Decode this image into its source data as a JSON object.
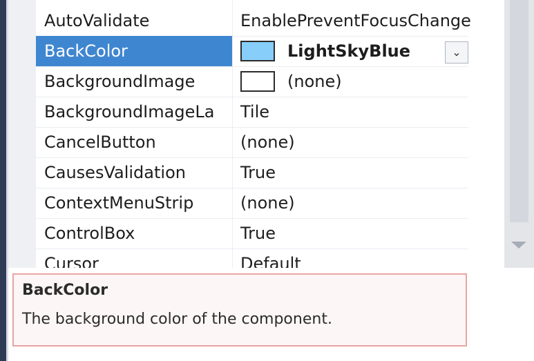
{
  "properties": [
    {
      "name": "AutoValidate",
      "value": "EnablePreventFocusChange"
    },
    {
      "name": "BackColor",
      "value": "LightSkyBlue",
      "selected": true
    },
    {
      "name": "BackgroundImage",
      "value": "(none)"
    },
    {
      "name": "BackgroundImageLa",
      "value": "Tile"
    },
    {
      "name": "CancelButton",
      "value": "(none)"
    },
    {
      "name": "CausesValidation",
      "value": "True"
    },
    {
      "name": "ContextMenuStrip",
      "value": "(none)"
    },
    {
      "name": "ControlBox",
      "value": "True"
    },
    {
      "name": "Cursor",
      "value": "Default"
    }
  ],
  "swatches": {
    "backcolor": "#87cefa",
    "backgroundimage": "#ffffff"
  },
  "dropdown_icon": "chevron-down-icon",
  "description": {
    "title": "BackColor",
    "text": "The background color of the component."
  }
}
